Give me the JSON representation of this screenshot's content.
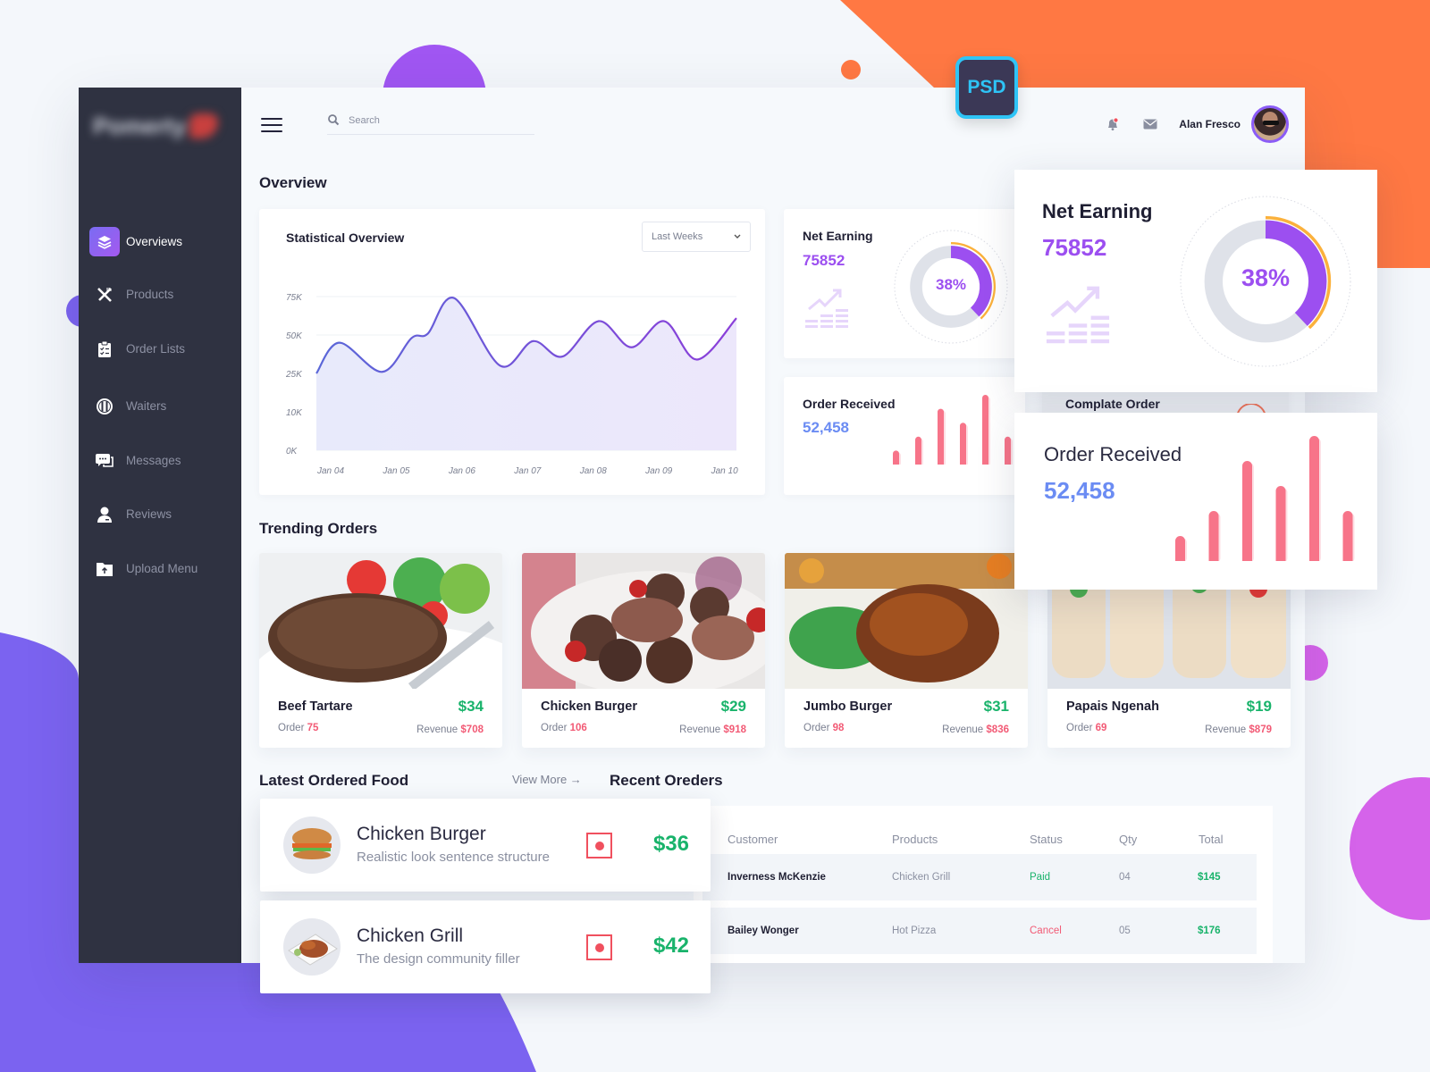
{
  "sidebar": {
    "logo_text": "Pomerty",
    "items": [
      {
        "label": "Overviews",
        "icon": "layers-icon",
        "active": true
      },
      {
        "label": "Products",
        "icon": "fork-knife-icon",
        "active": false
      },
      {
        "label": "Order Lists",
        "icon": "clipboard-list-icon",
        "active": false
      },
      {
        "label": "Waiters",
        "icon": "plate-icon",
        "active": false
      },
      {
        "label": "Messages",
        "icon": "chat-icon",
        "active": false
      },
      {
        "label": "Reviews",
        "icon": "user-icon",
        "active": false
      },
      {
        "label": "Upload Menu",
        "icon": "upload-folder-icon",
        "active": false
      }
    ]
  },
  "topbar": {
    "search_placeholder": "Search",
    "user_name": "Alan Fresco",
    "badge_label": "PSD"
  },
  "overview": {
    "title": "Overview",
    "statistical": {
      "title": "Statistical Overview",
      "range_select": "Last Weeks"
    },
    "net_earning": {
      "title": "Net Earning",
      "value": "75852",
      "percent_label": "38%",
      "percent": 38
    },
    "order_received": {
      "title": "Order Received",
      "value": "52,458",
      "bars": [
        2,
        4,
        8,
        6,
        10,
        4
      ]
    },
    "complete_order": {
      "title": "Complate Order"
    }
  },
  "chart_data": {
    "type": "area",
    "title": "Statistical Overview",
    "xlabel": "",
    "ylabel": "",
    "categories": [
      "Jan 04",
      "Jan 05",
      "Jan 06",
      "Jan 07",
      "Jan 08",
      "Jan 09",
      "Jan 10"
    ],
    "y_tick_labels": [
      "0K",
      "10K",
      "25K",
      "50K",
      "75K"
    ],
    "y_tick_values": [
      0,
      10000,
      25000,
      50000,
      75000
    ],
    "x": [
      0,
      0.35,
      1.0,
      1.45,
      1.7,
      2.1,
      2.8,
      3.3,
      3.75,
      4.3,
      4.8,
      5.3,
      5.8,
      6.4
    ],
    "values": [
      25000,
      45000,
      26000,
      48000,
      51000,
      74000,
      30000,
      46000,
      36000,
      59000,
      42000,
      59000,
      34000,
      61000
    ],
    "ylim": [
      0,
      75000
    ],
    "grid": true,
    "colors": {
      "line_start": "#5a67d8",
      "line_end": "#8b3fd9",
      "fill": "#ece7fb"
    }
  },
  "trending": {
    "title": "Trending Orders",
    "items": [
      {
        "name": "Beef Tartare",
        "price": "$34",
        "order_label": "Order",
        "order": "75",
        "revenue_label": "Revenue",
        "revenue": "$708"
      },
      {
        "name": "Chicken Burger",
        "price": "$29",
        "order_label": "Order",
        "order": "106",
        "revenue_label": "Revenue",
        "revenue": "$918"
      },
      {
        "name": "Jumbo Burger",
        "price": "$31",
        "order_label": "Order",
        "order": "98",
        "revenue_label": "Revenue",
        "revenue": "$836"
      },
      {
        "name": "Papais Ngenah",
        "price": "$19",
        "order_label": "Order",
        "order": "69",
        "revenue_label": "Revenue",
        "revenue": "$879"
      }
    ]
  },
  "latest": {
    "title": "Latest Ordered Food",
    "view_more": "View More →",
    "items": [
      {
        "name": "Chicken Burger",
        "desc": "Realistic look sentence structure",
        "price": "$36"
      },
      {
        "name": "Chicken Grill",
        "desc": "The design community filler",
        "price": "$42"
      }
    ]
  },
  "recent_orders": {
    "title": "Recent Oreders",
    "columns": [
      "Customer",
      "Products",
      "Status",
      "Qty",
      "Total"
    ],
    "rows": [
      {
        "customer": "Inverness McKenzie",
        "product": "Chicken Grill",
        "status": "Paid",
        "qty": "04",
        "total": "$145"
      },
      {
        "customer": "Bailey Wonger",
        "product": "Hot Pizza",
        "status": "Cancel",
        "qty": "05",
        "total": "$176"
      }
    ]
  },
  "colors": {
    "sidebar_bg": "#2f3241",
    "accent_purple": "#9c4ff0",
    "accent_blue": "#6b8cf3",
    "accent_green": "#19b36b",
    "accent_red": "#f25a75",
    "orange_decor": "#ff7843",
    "violet_decor": "#7b63f0"
  }
}
